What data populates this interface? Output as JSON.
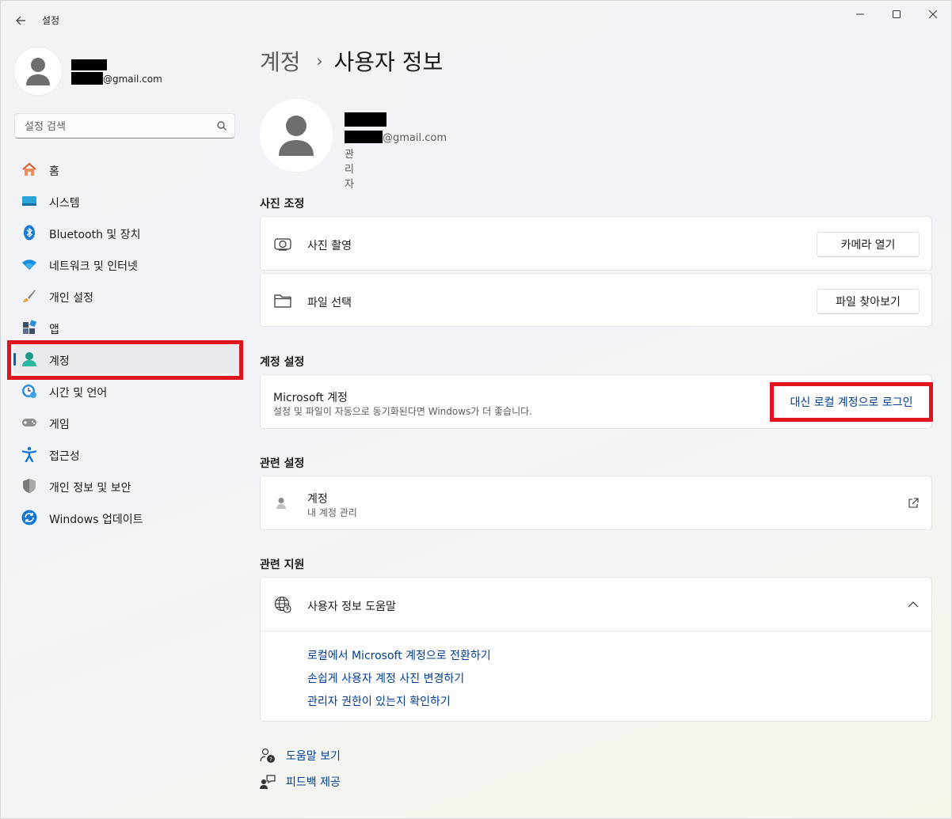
{
  "window": {
    "app_title": "설정"
  },
  "user": {
    "email_suffix": "@gmail.com"
  },
  "search": {
    "placeholder": "설정 검색"
  },
  "sidebar": {
    "items": [
      {
        "label": "홈",
        "icon": "home-icon"
      },
      {
        "label": "시스템",
        "icon": "system-icon"
      },
      {
        "label": "Bluetooth 및 장치",
        "icon": "bluetooth-icon"
      },
      {
        "label": "네트워크 및 인터넷",
        "icon": "wifi-icon"
      },
      {
        "label": "개인 설정",
        "icon": "brush-icon"
      },
      {
        "label": "앱",
        "icon": "apps-icon"
      },
      {
        "label": "계정",
        "icon": "account-icon",
        "active": true
      },
      {
        "label": "시간 및 언어",
        "icon": "time-language-icon"
      },
      {
        "label": "게임",
        "icon": "gaming-icon"
      },
      {
        "label": "접근성",
        "icon": "accessibility-icon"
      },
      {
        "label": "개인 정보 및 보안",
        "icon": "shield-icon"
      },
      {
        "label": "Windows 업데이트",
        "icon": "update-icon"
      }
    ]
  },
  "breadcrumb": {
    "parent": "계정",
    "separator": "›",
    "current": "사용자 정보"
  },
  "profile": {
    "email_suffix": "@gmail.com",
    "role": "관리자"
  },
  "photo_section": {
    "title": "사진 조정",
    "take_photo_label": "사진 촬영",
    "camera_button": "카메라 열기",
    "choose_file_label": "파일 선택",
    "browse_button": "파일 찾아보기"
  },
  "account_settings": {
    "title": "계정 설정",
    "ms_account_title": "Microsoft 계정",
    "ms_account_sub": "설정 및 파일이 자동으로 동기화된다면 Windows가 더 좋습니다.",
    "local_signin_link": "대신 로컬 계정으로 로그인"
  },
  "related_settings": {
    "title": "관련 설정",
    "accounts_title": "계정",
    "accounts_sub": "내 계정 관리"
  },
  "related_support": {
    "title": "관련 지원",
    "help_title": "사용자 정보 도움말",
    "links": [
      "로컬에서 Microsoft 계정으로 전환하기",
      "손쉽게 사용자 계정 사진 변경하기",
      "관리자 권한이 있는지 확인하기"
    ]
  },
  "footer": {
    "get_help": "도움말 보기",
    "give_feedback": "피드백 제공"
  },
  "colors": {
    "accent": "#005fb8",
    "link": "#003e92",
    "highlight_red": "#e0141e"
  }
}
